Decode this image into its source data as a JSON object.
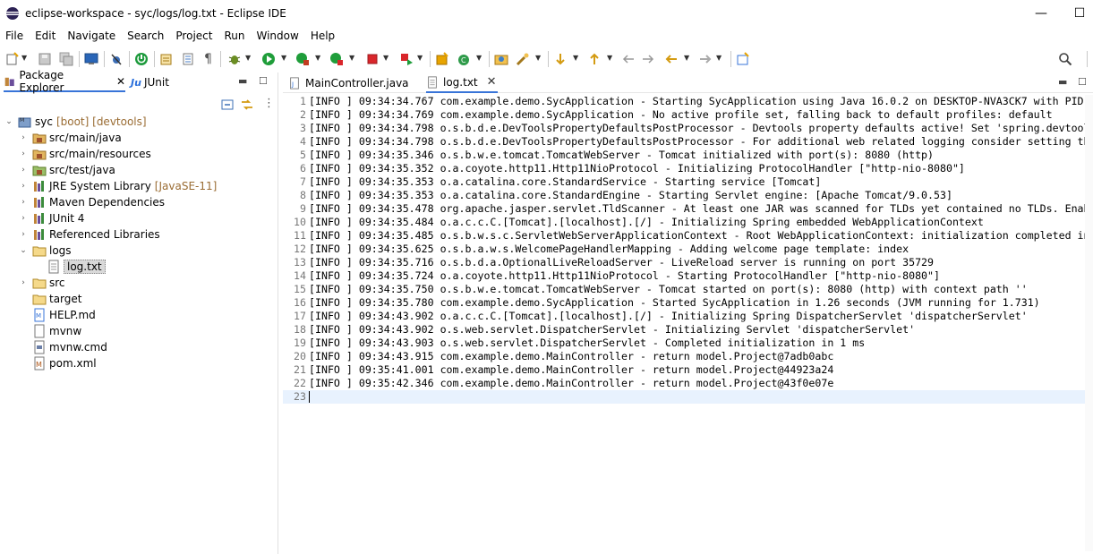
{
  "window": {
    "title": "eclipse-workspace - syc/logs/log.txt - Eclipse IDE",
    "minimize": "—",
    "maximize": "☐"
  },
  "menu": [
    "File",
    "Edit",
    "Navigate",
    "Search",
    "Project",
    "Run",
    "Window",
    "Help"
  ],
  "left_panel": {
    "tabs": [
      {
        "label": "Package Explorer",
        "close": "✕",
        "active": true
      },
      {
        "label": "JUnit",
        "active": false
      }
    ],
    "tree": [
      {
        "label": "syc",
        "decoration": "[boot] [devtools]",
        "icon": "project-icon",
        "expanded": true,
        "level": 0
      },
      {
        "label": "src/main/java",
        "icon": "source-folder-icon",
        "expanded": false,
        "level": 1
      },
      {
        "label": "src/main/resources",
        "icon": "source-folder-icon",
        "expanded": false,
        "level": 1
      },
      {
        "label": "src/test/java",
        "icon": "source-folder-icon",
        "expanded": false,
        "level": 1
      },
      {
        "label": "JRE System Library",
        "decoration": "[JavaSE-11]",
        "icon": "library-icon",
        "expanded": false,
        "level": 1
      },
      {
        "label": "Maven Dependencies",
        "icon": "library-icon",
        "expanded": false,
        "level": 1
      },
      {
        "label": "JUnit 4",
        "icon": "library-icon",
        "expanded": false,
        "level": 1
      },
      {
        "label": "Referenced Libraries",
        "icon": "library-icon",
        "expanded": false,
        "level": 1
      },
      {
        "label": "logs",
        "icon": "folder-icon",
        "expanded": true,
        "level": 1
      },
      {
        "label": "log.txt",
        "icon": "text-file-icon",
        "level": 2,
        "selected": true
      },
      {
        "label": "src",
        "icon": "folder-icon",
        "expanded": false,
        "level": 1
      },
      {
        "label": "target",
        "icon": "folder-icon",
        "level": 1
      },
      {
        "label": "HELP.md",
        "icon": "file-icon",
        "level": 1
      },
      {
        "label": "mvnw",
        "icon": "file-icon",
        "level": 1
      },
      {
        "label": "mvnw.cmd",
        "icon": "file-icon",
        "level": 1
      },
      {
        "label": "pom.xml",
        "icon": "xml-file-icon",
        "level": 1
      }
    ]
  },
  "editor": {
    "tabs": [
      {
        "label": "MainController.java",
        "active": false
      },
      {
        "label": "log.txt",
        "active": true,
        "close": "✕"
      }
    ],
    "lines": [
      "[INFO ] 09:34:34.767 com.example.demo.SycApplication - Starting SycApplication using Java 16.0.2 on DESKTOP-NVA3CK7 with PID (",
      "[INFO ] 09:34:34.769 com.example.demo.SycApplication - No active profile set, falling back to default profiles: default",
      "[INFO ] 09:34:34.798 o.s.b.d.e.DevToolsPropertyDefaultsPostProcessor - Devtools property defaults active! Set 'spring.devtool",
      "[INFO ] 09:34:34.798 o.s.b.d.e.DevToolsPropertyDefaultsPostProcessor - For additional web related logging consider setting th",
      "[INFO ] 09:34:35.346 o.s.b.w.e.tomcat.TomcatWebServer - Tomcat initialized with port(s): 8080 (http)",
      "[INFO ] 09:34:35.352 o.a.coyote.http11.Http11NioProtocol - Initializing ProtocolHandler [\"http-nio-8080\"]",
      "[INFO ] 09:34:35.353 o.a.catalina.core.StandardService - Starting service [Tomcat]",
      "[INFO ] 09:34:35.353 o.a.catalina.core.StandardEngine - Starting Servlet engine: [Apache Tomcat/9.0.53]",
      "[INFO ] 09:34:35.478 org.apache.jasper.servlet.TldScanner - At least one JAR was scanned for TLDs yet contained no TLDs. Enab",
      "[INFO ] 09:34:35.484 o.a.c.c.C.[Tomcat].[localhost].[/] - Initializing Spring embedded WebApplicationContext",
      "[INFO ] 09:34:35.485 o.s.b.w.s.c.ServletWebServerApplicationContext - Root WebApplicationContext: initialization completed in",
      "[INFO ] 09:34:35.625 o.s.b.a.w.s.WelcomePageHandlerMapping - Adding welcome page template: index",
      "[INFO ] 09:34:35.716 o.s.b.d.a.OptionalLiveReloadServer - LiveReload server is running on port 35729",
      "[INFO ] 09:34:35.724 o.a.coyote.http11.Http11NioProtocol - Starting ProtocolHandler [\"http-nio-8080\"]",
      "[INFO ] 09:34:35.750 o.s.b.w.e.tomcat.TomcatWebServer - Tomcat started on port(s): 8080 (http) with context path ''",
      "[INFO ] 09:34:35.780 com.example.demo.SycApplication - Started SycApplication in 1.26 seconds (JVM running for 1.731)",
      "[INFO ] 09:34:43.902 o.a.c.c.C.[Tomcat].[localhost].[/] - Initializing Spring DispatcherServlet 'dispatcherServlet'",
      "[INFO ] 09:34:43.902 o.s.web.servlet.DispatcherServlet - Initializing Servlet 'dispatcherServlet'",
      "[INFO ] 09:34:43.903 o.s.web.servlet.DispatcherServlet - Completed initialization in 1 ms",
      "[INFO ] 09:34:43.915 com.example.demo.MainController - return model.Project@7adb0abc",
      "[INFO ] 09:35:41.001 com.example.demo.MainController - return model.Project@44923a24",
      "[INFO ] 09:35:42.346 com.example.demo.MainController - return model.Project@43f0e07e",
      ""
    ],
    "current_line": 23
  }
}
